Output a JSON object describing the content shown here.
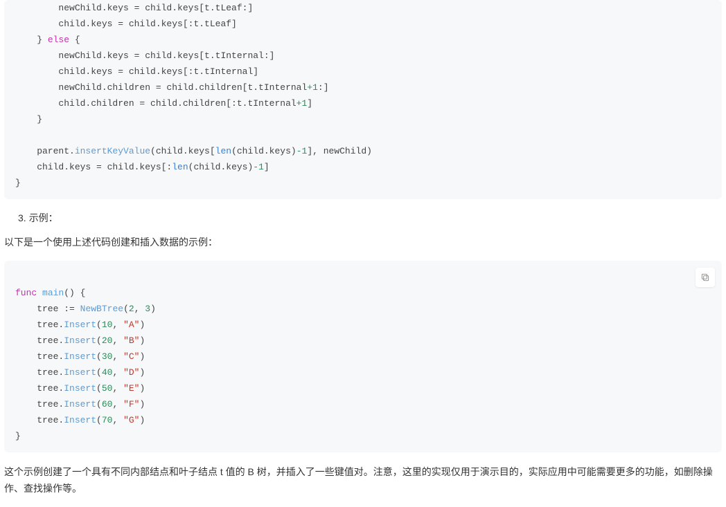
{
  "code1": {
    "l1": "        newChild.keys = child.keys[t.tLeaf:]",
    "l2": "        child.keys = child.keys[:t.tLeaf]",
    "l3a": "    } ",
    "l3b": "else",
    "l3c": " {",
    "l4": "        newChild.keys = child.keys[t.tInternal:]",
    "l5": "        child.keys = child.keys[:t.tInternal]",
    "l6a": "        newChild.children = child.children[t.tInternal",
    "l6b": "+1",
    "l6c": ":]",
    "l7a": "        child.children = child.children[:t.tInternal",
    "l7b": "+1",
    "l7c": "]",
    "l8": "    }",
    "l9": "",
    "l10a": "    parent.",
    "l10b": "insertKeyValue",
    "l10c": "(child.keys[",
    "l10d": "len",
    "l10e": "(child.keys)",
    "l10f": "-1",
    "l10g": "], newChild)",
    "l11a": "    child.keys = child.keys[:",
    "l11b": "len",
    "l11c": "(child.keys)",
    "l11d": "-1",
    "l11e": "]",
    "l12": "}"
  },
  "list": {
    "num": "3.",
    "label": "示例："
  },
  "intro": "以下是一个使用上述代码创建和插入数据的示例：",
  "code2": {
    "m1a": "func",
    "m1b": " ",
    "m1c": "main",
    "m1d": "() {",
    "m2a": "    tree ",
    "m2op": ":=",
    "m2b": " ",
    "m2f": "NewBTree",
    "m2c": "(",
    "m2n1": "2",
    "m2cm": ", ",
    "m2n2": "3",
    "m2d": ")",
    "m3a": "    tree.",
    "m3f": "Insert",
    "m3b": "(",
    "m3n": "10",
    "m3c": ", ",
    "m3s": "\"A\"",
    "m3d": ")",
    "m4a": "    tree.",
    "m4f": "Insert",
    "m4b": "(",
    "m4n": "20",
    "m4c": ", ",
    "m4s": "\"B\"",
    "m4d": ")",
    "m5a": "    tree.",
    "m5f": "Insert",
    "m5b": "(",
    "m5n": "30",
    "m5c": ", ",
    "m5s": "\"C\"",
    "m5d": ")",
    "m6a": "    tree.",
    "m6f": "Insert",
    "m6b": "(",
    "m6n": "40",
    "m6c": ", ",
    "m6s": "\"D\"",
    "m6d": ")",
    "m7a": "    tree.",
    "m7f": "Insert",
    "m7b": "(",
    "m7n": "50",
    "m7c": ", ",
    "m7s": "\"E\"",
    "m7d": ")",
    "m8a": "    tree.",
    "m8f": "Insert",
    "m8b": "(",
    "m8n": "60",
    "m8c": ", ",
    "m8s": "\"F\"",
    "m8d": ")",
    "m9a": "    tree.",
    "m9f": "Insert",
    "m9b": "(",
    "m9n": "70",
    "m9c": ", ",
    "m9s": "\"G\"",
    "m9d": ")",
    "m10": "}"
  },
  "outro": "这个示例创建了一个具有不同内部结点和叶子结点 t 值的 B 树，并插入了一些键值对。注意，这里的实现仅用于演示目的，实际应用中可能需要更多的功能，如删除操作、查找操作等。"
}
